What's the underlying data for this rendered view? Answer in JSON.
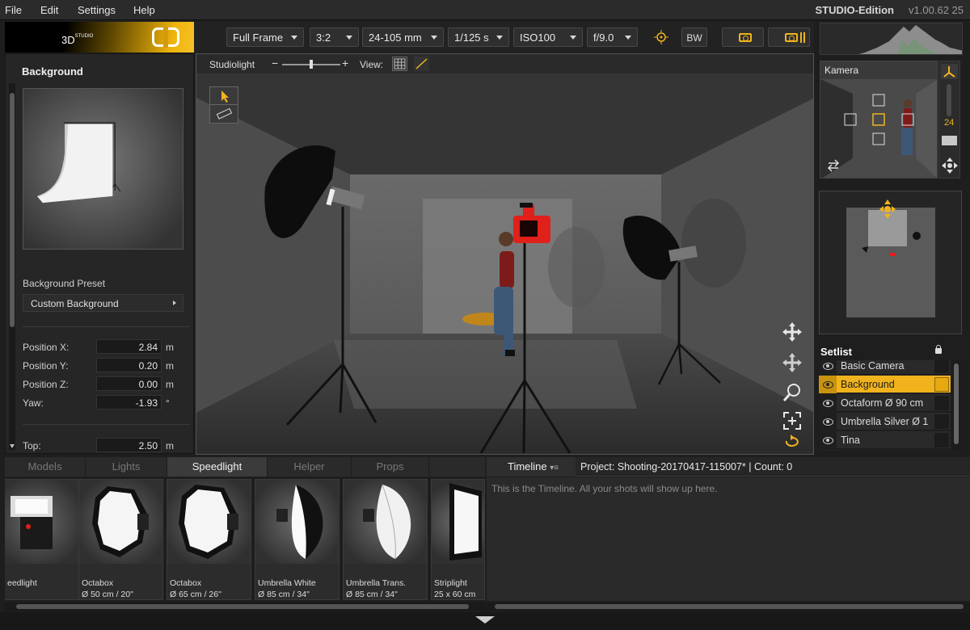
{
  "menu": {
    "file": "File",
    "edit": "Edit",
    "settings": "Settings",
    "help": "Help"
  },
  "app": {
    "edition": "STUDIO-Edition",
    "version": "v1.00.62 25"
  },
  "logo": {
    "text": "3D",
    "sup": "STUDIO"
  },
  "toolbar": {
    "sensor": "Full Frame",
    "ratio": "3:2",
    "lens": "24-105 mm",
    "shutter": "1/125 s",
    "iso": "ISO100",
    "aperture": "f/9.0",
    "bw_label": "BW"
  },
  "left_panel": {
    "title": "Background",
    "preset_label": "Background Preset",
    "preset_value": "Custom Background",
    "fields": [
      {
        "label": "Position X:",
        "value": "2.84",
        "unit": "m"
      },
      {
        "label": "Position Y:",
        "value": "0.20",
        "unit": "m"
      },
      {
        "label": "Position Z:",
        "value": "0.00",
        "unit": "m"
      },
      {
        "label": "Yaw:",
        "value": "-1.93",
        "unit": "°"
      },
      {
        "label": "Top:",
        "value": "2.50",
        "unit": "m"
      }
    ]
  },
  "viewport": {
    "studiolight_label": "Studiolight",
    "minus": "−",
    "plus": "+",
    "view_label": "View:"
  },
  "camera_preview": {
    "title": "Kamera",
    "zoom_value": "24"
  },
  "setlist": {
    "title": "Setlist",
    "items": [
      {
        "name": "Basic Camera",
        "selected": false
      },
      {
        "name": "Background",
        "selected": true
      },
      {
        "name": "Octaform Ø 90 cm",
        "selected": false
      },
      {
        "name": "Umbrella Silver Ø 1",
        "selected": false
      },
      {
        "name": "Tina",
        "selected": false
      }
    ]
  },
  "library": {
    "tabs": [
      {
        "label": "Models",
        "active": false
      },
      {
        "label": "Lights",
        "active": false
      },
      {
        "label": "Speedlight",
        "active": true
      },
      {
        "label": "Helper",
        "active": false
      },
      {
        "label": "Props",
        "active": false
      }
    ],
    "items": [
      {
        "line1": "eedlight",
        "line2": ""
      },
      {
        "line1": "Octabox",
        "line2": "Ø 50  cm / 20\""
      },
      {
        "line1": "Octabox",
        "line2": "Ø 65 cm / 26\""
      },
      {
        "line1": "Umbrella White",
        "line2": "Ø 85 cm / 34\""
      },
      {
        "line1": "Umbrella Trans.",
        "line2": "Ø 85 cm / 34\""
      },
      {
        "line1": "Striplight",
        "line2": "25 x 60 cm"
      }
    ]
  },
  "timeline": {
    "tab_label": "Timeline",
    "project": "Project: Shooting-20170417-115007*  |  Count: 0",
    "empty_message": "This is the Timeline. All your shots will show up here."
  },
  "colors": {
    "accent": "#f0b31d",
    "camera_red": "#e0201a"
  },
  "icons": [
    "camera-icon",
    "camera-burst-icon",
    "focus-icon",
    "cursor-icon",
    "ruler-icon",
    "grid-icon",
    "line-icon",
    "move-icon",
    "pan-icon",
    "zoom-icon",
    "frame-icon",
    "rotate-icon",
    "eye-icon",
    "lock-icon"
  ]
}
